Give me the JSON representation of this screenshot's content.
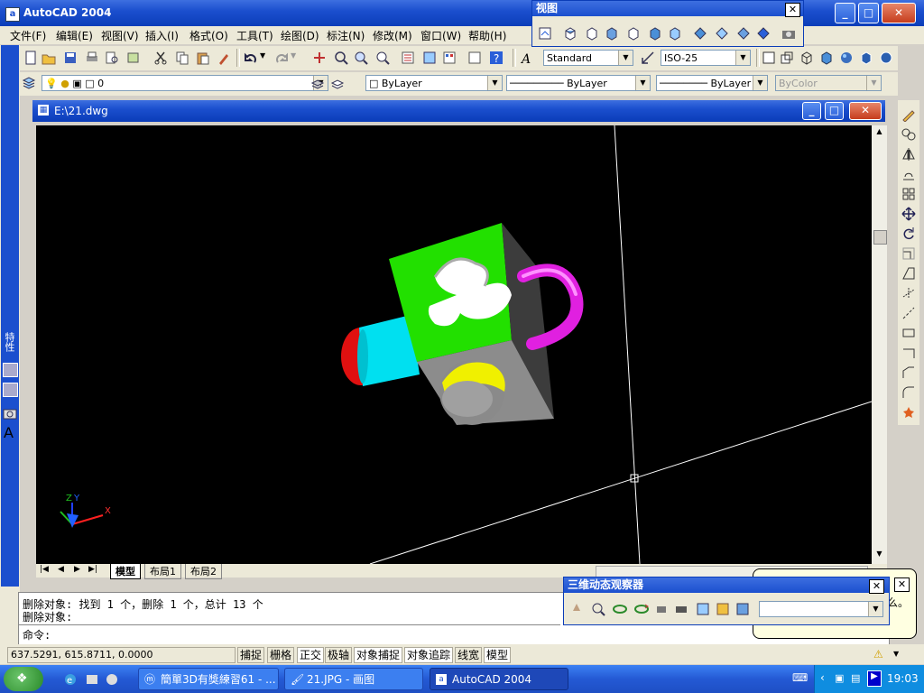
{
  "window": {
    "title": "AutoCAD 2004",
    "app_icon": "a"
  },
  "menu": [
    "文件(F)",
    "编辑(E)",
    "视图(V)",
    "插入(I)",
    "格式(O)",
    "工具(T)",
    "绘图(D)",
    "标注(N)",
    "修改(M)",
    "窗口(W)",
    "帮助(H)"
  ],
  "styles": {
    "text_style": "Standard",
    "dim_style": "ISO-25"
  },
  "layers": {
    "current_layer": "0",
    "color": "ByLayer",
    "linetype": "ByLayer",
    "lineweight": "ByLayer",
    "plot_style": "ByColor"
  },
  "view_toolbar": {
    "title": "视图"
  },
  "orbit_toolbar": {
    "title": "三维动态观察器",
    "combo": ""
  },
  "drawing": {
    "title": "E:\\21.dwg"
  },
  "ucs": {
    "x": "X",
    "y": "Y",
    "z": "Z"
  },
  "layout_tabs": [
    "模型",
    "布局1",
    "布局2"
  ],
  "command": {
    "line1": "删除对象: 找到 1 个，删除 1 个，总计 13 个",
    "line2": "删除对象:",
    "prompt": "命令:",
    "balloon_tail": "么。"
  },
  "status": {
    "coords": "637.5291, 615.8711, 0.0000",
    "toggles": [
      "捕捉",
      "栅格",
      "正交",
      "极轴",
      "对象捕捉",
      "对象追踪",
      "线宽",
      "模型"
    ]
  },
  "sidebar": {
    "label": "特性"
  },
  "taskbar": {
    "items": [
      "簡單3D有獎練習61 - ...",
      "21.JPG - 画图",
      "AutoCAD 2004"
    ],
    "clock": "19:03"
  },
  "colors": {
    "title_blue": "#1b4fce",
    "viewport_bg": "#000000",
    "cube_green": "#22e000",
    "magenta": "#e020e0",
    "cyan": "#00e0f0",
    "red": "#e01010",
    "yellow": "#f0f000"
  }
}
